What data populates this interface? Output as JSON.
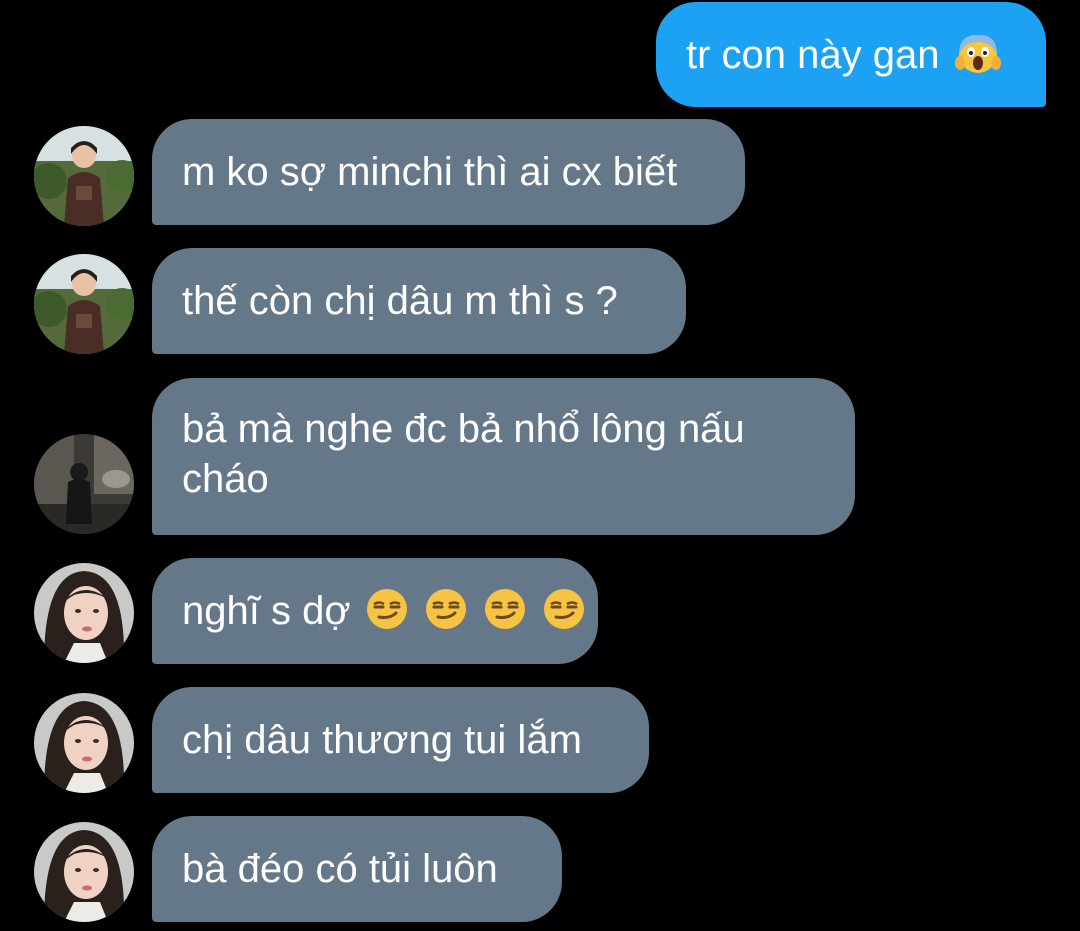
{
  "colors": {
    "background": "#000000",
    "outgoing_bubble": "#1da1f2",
    "incoming_bubble": "#64788a",
    "text": "#ffffff"
  },
  "messages": [
    {
      "direction": "outgoing",
      "text": "tr con này gan",
      "emojis": [
        "screaming-face-emoji"
      ]
    },
    {
      "direction": "incoming",
      "avatar": "child-outdoor-avatar",
      "text": "m ko sợ minchi thì ai cx biết"
    },
    {
      "direction": "incoming",
      "avatar": "child-outdoor-avatar",
      "text": "thế còn chị dâu m thì s ?"
    },
    {
      "direction": "incoming",
      "avatar": "street-person-avatar",
      "lines": [
        "bả mà nghe đc bả nhổ lông nấu",
        "cháo"
      ]
    },
    {
      "direction": "incoming",
      "avatar": "girl-portrait-avatar",
      "text": "nghĩ s dợ",
      "emojis": [
        "smirking-face-emoji",
        "smirking-face-emoji",
        "smirking-face-emoji",
        "smirking-face-emoji"
      ]
    },
    {
      "direction": "incoming",
      "avatar": "girl-portrait-avatar",
      "text": "chị dâu thương tui lắm"
    },
    {
      "direction": "incoming",
      "avatar": "girl-portrait-avatar",
      "text": "bà đéo có tủi luôn"
    }
  ]
}
